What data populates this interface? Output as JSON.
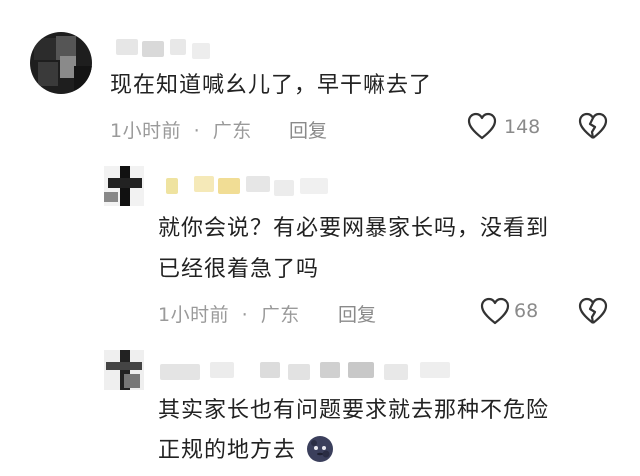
{
  "comments": [
    {
      "text": "现在知道喊幺儿了，早干嘛去了",
      "time": "1小时前",
      "separator": "·",
      "location": "广东",
      "reply_label": "回复",
      "likes": "148"
    },
    {
      "text_line1": "就你会说？有必要网暴家长吗，没看到",
      "text_line2": "已经很着急了吗",
      "time": "1小时前",
      "separator": "·",
      "location": "广东",
      "reply_label": "回复",
      "likes": "68"
    },
    {
      "text_line1": "其实家长也有问题要求就去那种不危险",
      "text_line2": "正规的地方去",
      "emoji": "moon-face-emoji"
    }
  ],
  "icons": {
    "like": "heart-outline-icon",
    "dislike": "broken-heart-icon"
  },
  "colors": {
    "text": "#222222",
    "meta": "#9a9a9a",
    "icon": "#333333"
  }
}
